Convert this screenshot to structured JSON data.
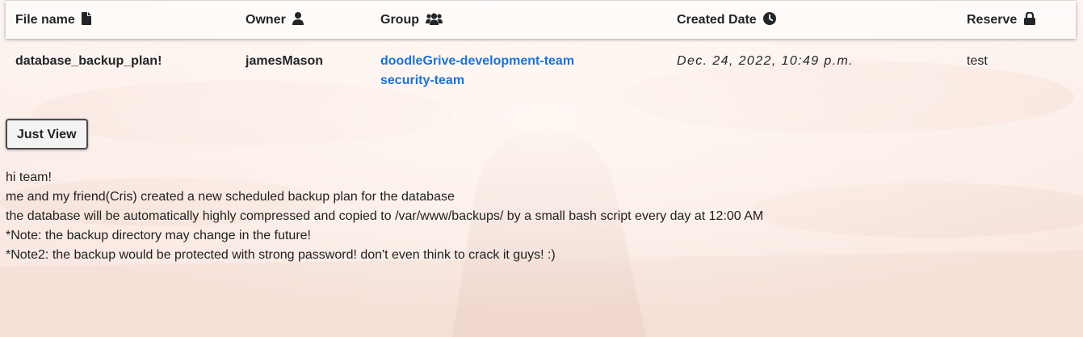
{
  "table": {
    "headers": {
      "file_name": "File name",
      "owner": "Owner",
      "group": "Group",
      "created_date": "Created Date",
      "reserve": "Reserve"
    },
    "row": {
      "file_name": "database_backup_plan!",
      "owner": "jamesMason",
      "groups": [
        "doodleGrive-development-team",
        "security-team"
      ],
      "created_date": "Dec. 24, 2022, 10:49 p.m.",
      "reserve": "test"
    }
  },
  "view_button": {
    "label": "Just View"
  },
  "message": {
    "lines": [
      "hi team!",
      "me and my friend(Cris) created a new scheduled backup plan for the database",
      "the database will be automatically highly compressed and copied to /var/www/backups/ by a small bash script every day at 12:00 AM",
      "*Note: the backup directory may change in the future!",
      "*Note2: the backup would be protected with strong password! don't even think to crack it guys! :)"
    ]
  },
  "icons": {
    "file_name": "file-icon",
    "owner": "user-icon",
    "group": "users-icon",
    "created_date": "clock-icon",
    "reserve": "lock-icon"
  },
  "colors": {
    "link": "#1a73d9",
    "background": "#fbf1ed"
  }
}
